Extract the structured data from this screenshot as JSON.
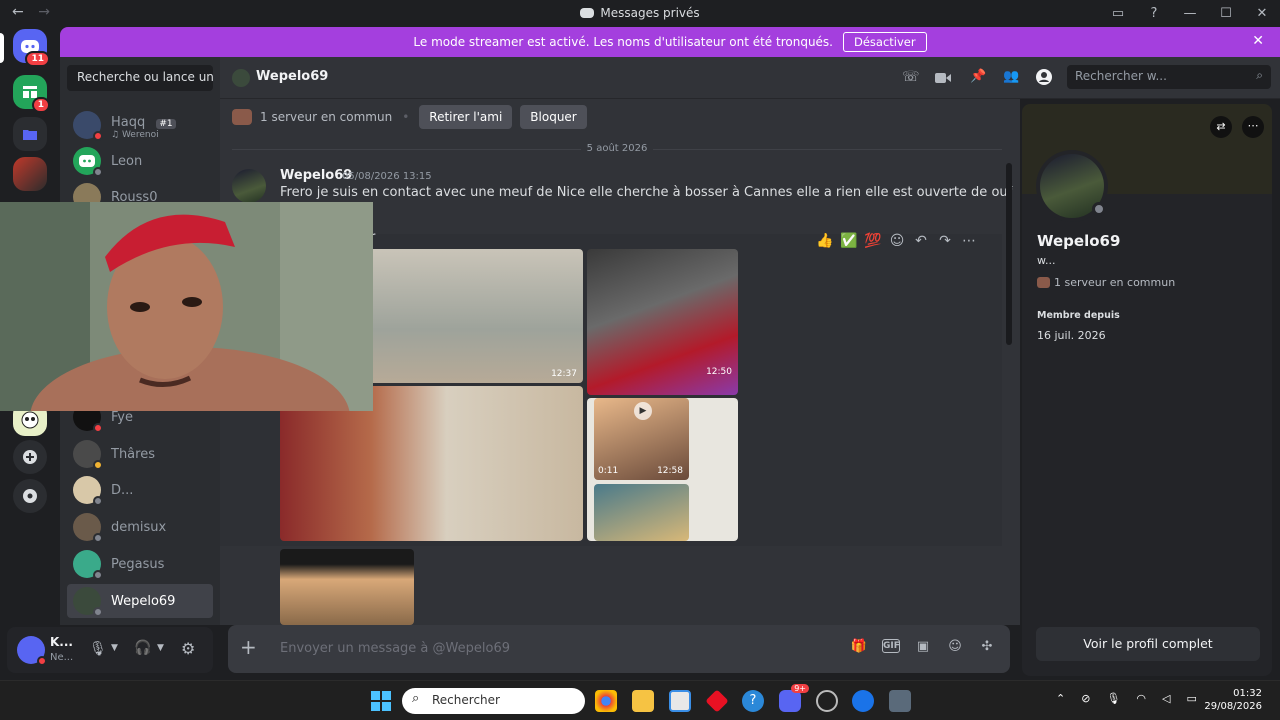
{
  "window": {
    "title": "Messages privés",
    "back": "←",
    "forward": "→"
  },
  "banner": {
    "text": "Le mode streamer est activé. Les noms d'utilisateur ont été tronqués.",
    "button": "Désactiver",
    "close": "✕"
  },
  "servers": {
    "home_badge": "11",
    "second_badge": "1"
  },
  "dm_list": {
    "search_placeholder": "Recherche ou lance un...",
    "items": [
      {
        "name": "Haqq",
        "tag": "#1",
        "activity": "Werenoi"
      },
      {
        "name": "Leon"
      },
      {
        "name": "Rouss0"
      },
      {
        "name": "Fye"
      },
      {
        "name": "Thâres"
      },
      {
        "name": "D..."
      },
      {
        "name": "demisux"
      },
      {
        "name": "Pegasus"
      },
      {
        "name": "Wepelo69"
      }
    ]
  },
  "user_panel": {
    "name": "K...",
    "status": "Ne..."
  },
  "chat_header": {
    "name": "Wepelo69",
    "search_placeholder": "Rechercher w..."
  },
  "chat": {
    "mutual_servers": "1 serveur en commun",
    "remove_friend": "Retirer l'ami",
    "block": "Bloquer",
    "date_separator": "5 août 2026",
    "messages": [
      {
        "author": "Wepelo69",
        "time": "05/08/2026 13:15",
        "text": "Frero je suis en contact avec une meuf de Nice elle cherche à bosser à Cannes elle a rien elle est ouverte de ouf"
      }
    ],
    "second_message_fragment": "r",
    "toolbar_emojis": [
      "👍",
      "✅",
      "💯"
    ],
    "video_durations": [
      "12:37",
      "12:50",
      "0:11",
      "12:58"
    ],
    "composer_placeholder": "Envoyer un message à @Wepelo69"
  },
  "profile": {
    "name": "Wepelo69",
    "username": "w...",
    "mutual_servers": "1 serveur en commun",
    "member_since_label": "Membre depuis",
    "member_since": "16 juil. 2026",
    "full_profile_button": "Voir le profil complet"
  },
  "taskbar": {
    "search": "Rechercher",
    "time": "01:32",
    "date": "29/08/2026",
    "discord_badge": "9+"
  }
}
